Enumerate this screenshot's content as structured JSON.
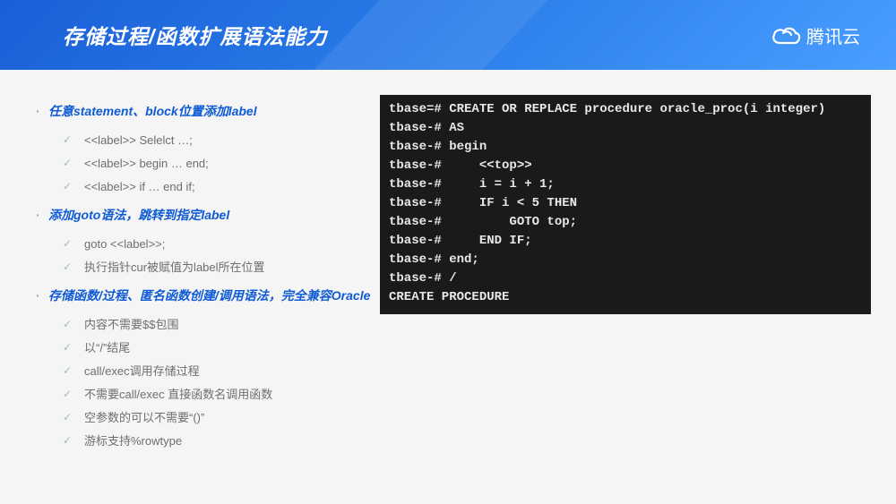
{
  "header": {
    "title": "存储过程/函数扩展语法能力",
    "brand_text": "腾讯云"
  },
  "sections": [
    {
      "title": "任意statement、block位置添加label",
      "items": [
        "<<label>> Selelct …;",
        "<<label>> begin … end;",
        "<<label>> if … end if;"
      ]
    },
    {
      "title": "添加goto语法，跳转到指定label",
      "items": [
        "goto <<label>>;",
        "执行指针cur被赋值为label所在位置"
      ]
    },
    {
      "title": "存储函数/过程、匿名函数创建/调用语法，完全兼容Oracle",
      "items": [
        "内容不需要$$包围",
        "以“/”结尾",
        "call/exec调用存储过程",
        "不需要call/exec 直接函数名调用函数",
        "空参数的可以不需要“()”",
        "游标支持%rowtype"
      ]
    }
  ],
  "terminal": "tbase=# CREATE OR REPLACE procedure oracle_proc(i integer)\ntbase-# AS\ntbase-# begin\ntbase-#     <<top>>\ntbase-#     i = i + 1;\ntbase-#     IF i < 5 THEN\ntbase-#         GOTO top;\ntbase-#     END IF;\ntbase-# end;\ntbase-# /\nCREATE PROCEDURE"
}
